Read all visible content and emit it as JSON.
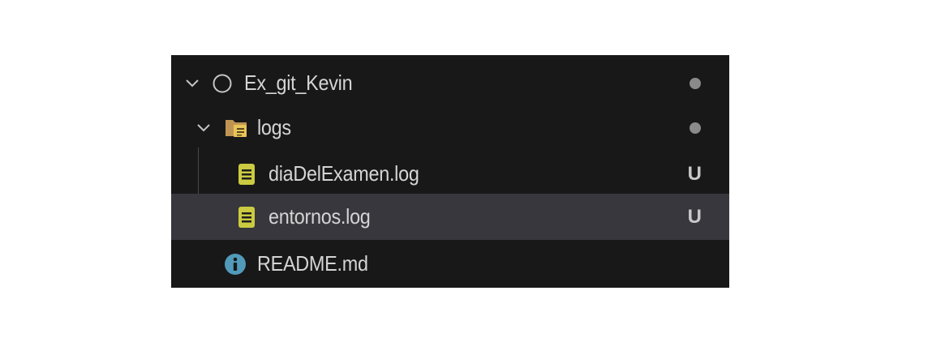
{
  "explorer": {
    "items": [
      {
        "label": "Ex_git_Kevin",
        "type": "repository",
        "expanded": true,
        "status": "dot"
      },
      {
        "label": "logs",
        "type": "folder",
        "expanded": true,
        "status": "dot"
      },
      {
        "label": "diaDelExamen.log",
        "type": "file",
        "icon": "log-file-icon",
        "status": "U"
      },
      {
        "label": "entornos.log",
        "type": "file",
        "icon": "log-file-icon",
        "status": "U",
        "selected": true
      },
      {
        "label": "README.md",
        "type": "file",
        "icon": "info-icon"
      }
    ]
  },
  "colors": {
    "background": "#181818",
    "selected_row": "#37373d",
    "log_icon": "#cbcb41",
    "folder_icon": "#c09553",
    "info_icon": "#519aba",
    "text": "#d4d4d4"
  }
}
